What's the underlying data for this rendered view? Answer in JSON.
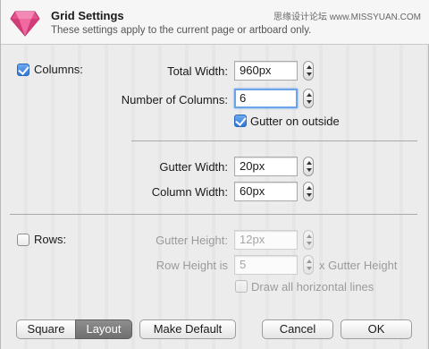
{
  "header": {
    "title": "Grid Settings",
    "subtitle": "These settings apply to the current page or artboard only.",
    "watermark": "思缘设计论坛 www.MISSYUAN.COM"
  },
  "columns": {
    "enable_label": "Columns:",
    "enabled": true,
    "total_width_label": "Total Width:",
    "total_width_value": "960px",
    "number_label": "Number of Columns:",
    "number_value": "6",
    "gutter_outside_label": "Gutter on outside",
    "gutter_outside_checked": true,
    "gutter_width_label": "Gutter Width:",
    "gutter_width_value": "20px",
    "column_width_label": "Column Width:",
    "column_width_value": "60px"
  },
  "rows": {
    "enable_label": "Rows:",
    "enabled": false,
    "gutter_height_label": "Gutter Height:",
    "gutter_height_value": "12px",
    "row_height_label": "Row Height is",
    "row_height_value": "5",
    "row_height_suffix": "x Gutter Height",
    "draw_lines_label": "Draw all horizontal lines"
  },
  "buttons": {
    "square": "Square",
    "layout": "Layout",
    "make_default": "Make Default",
    "cancel": "Cancel",
    "ok": "OK"
  }
}
